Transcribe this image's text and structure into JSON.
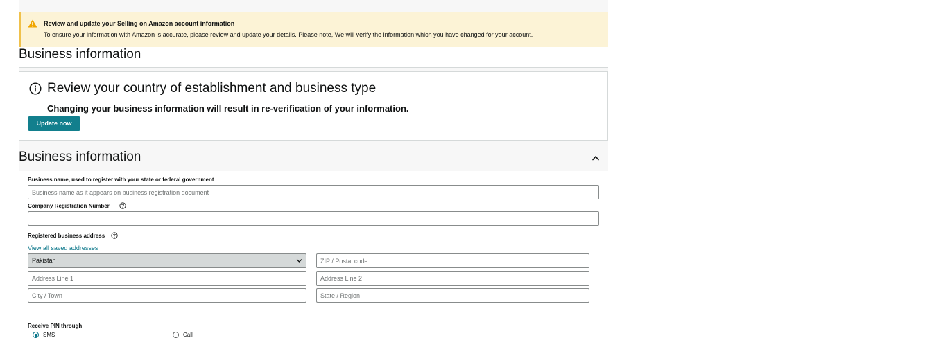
{
  "alert": {
    "icon": "warning-icon",
    "title": "Review and update your Selling on Amazon account information",
    "body": "To ensure your information with Amazon is accurate, please review and update your details. Please note, We will verify the information which you have changed for your account.",
    "background_color": "#fcf3d6"
  },
  "top_heading": "Business information",
  "review_box": {
    "icon": "info-icon",
    "title": "Review your country of establishment and business type",
    "subtitle": "Changing your business information will result in re-verification of your information.",
    "update_button": "Update now",
    "button_color": "#127f8d"
  },
  "section": {
    "heading": "Business information",
    "collapse_icon": "chevron-up-icon"
  },
  "form": {
    "business_name": {
      "label": "Business name, used to register with your state or federal government",
      "placeholder": "Business name as it appears on business registration document",
      "value": ""
    },
    "company_reg": {
      "label": "Company Registration Number",
      "help_icon": "question-circle-icon",
      "value": ""
    },
    "address": {
      "label": "Registered business address",
      "help_icon": "question-circle-icon",
      "saved_link": "View all saved addresses",
      "country": "Pakistan",
      "zip_placeholder": "ZIP / Postal code",
      "line1_placeholder": "Address Line 1",
      "line2_placeholder": "Address Line 2",
      "city_placeholder": "City / Town",
      "state_placeholder": "State / Region"
    },
    "pin": {
      "label": "Receive PIN through",
      "options": [
        {
          "label": "SMS",
          "selected": true
        },
        {
          "label": "Call",
          "selected": false
        }
      ]
    }
  },
  "colors": {
    "link": "#007185",
    "accent": "#127f8d"
  }
}
